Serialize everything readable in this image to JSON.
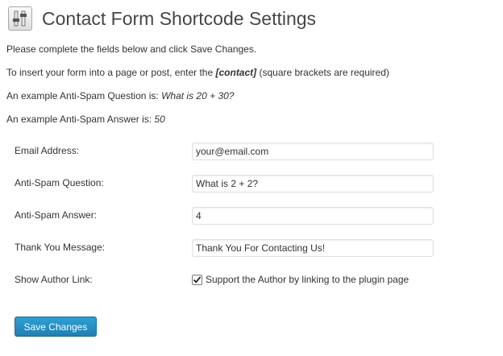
{
  "page": {
    "title": "Contact Form Shortcode Settings",
    "icon": "settings-sliders-icon"
  },
  "intro": {
    "line1": "Please complete the fields below and click Save Changes.",
    "line2_prefix": "To insert your form into a page or post, enter the ",
    "line2_shortcode": "[contact]",
    "line2_suffix": " (square brackets are required)",
    "line3_prefix": "An example Anti-Spam Question is: ",
    "line3_example": "What is 20 + 30?",
    "line4_prefix": "An example Anti-Spam Answer is: ",
    "line4_example": "50"
  },
  "form": {
    "email": {
      "label": "Email Address:",
      "value": "your@email.com"
    },
    "question": {
      "label": "Anti-Spam Question:",
      "value": "What is 2 + 2?"
    },
    "answer": {
      "label": "Anti-Spam Answer:",
      "value": "4"
    },
    "thanks": {
      "label": "Thank You Message:",
      "value": "Thank You For Contacting Us!"
    },
    "author_link": {
      "label": "Show Author Link:",
      "checkbox_label": "Support the Author by linking to the plugin page",
      "checked": true
    }
  },
  "actions": {
    "save_label": "Save Changes"
  },
  "colors": {
    "button": "#2180b3",
    "title": "#464646",
    "text": "#333333"
  }
}
